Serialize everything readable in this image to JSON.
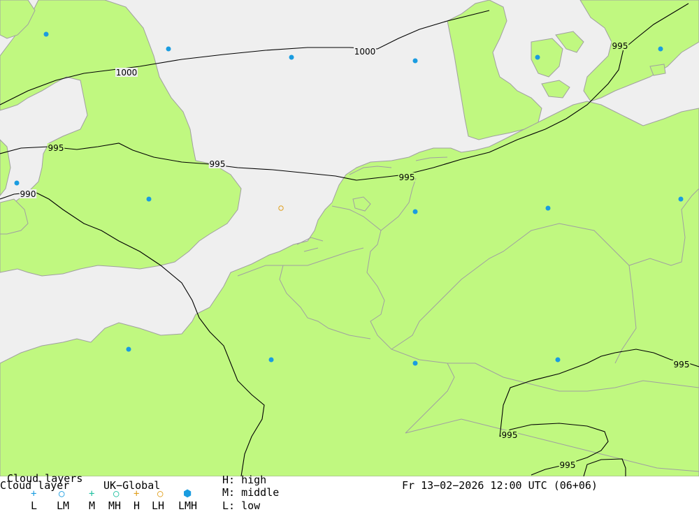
{
  "legend": {
    "title_overlay": "Cloud layers",
    "title": "Cloud layer",
    "model": "UK−Global",
    "symbols": [
      {
        "label": "L",
        "glyph": "+",
        "color": "#1a9ce0"
      },
      {
        "label": "LM",
        "glyph": "○",
        "color": "#1a9ce0"
      },
      {
        "label": "M",
        "glyph": "+",
        "color": "#20c0a0"
      },
      {
        "label": "MH",
        "glyph": "○",
        "color": "#20c0a0"
      },
      {
        "label": "H",
        "glyph": "+",
        "color": "#e0a020"
      },
      {
        "label": "LH",
        "glyph": "○",
        "color": "#e0a020"
      },
      {
        "label": "LMH",
        "glyph": "⬢",
        "color": "#1a9ce0"
      }
    ],
    "key": {
      "high": "H: high",
      "middle": "M: middle",
      "low": "L: low"
    }
  },
  "valid_time": "Fr 13−02−2026 12:00 UTC (06+06)",
  "isobars": [
    {
      "value": "1000"
    },
    {
      "value": "1000"
    },
    {
      "value": "995"
    },
    {
      "value": "995"
    },
    {
      "value": "995"
    },
    {
      "value": "990"
    },
    {
      "value": "995"
    },
    {
      "value": "995"
    },
    {
      "value": "995"
    },
    {
      "value": "995"
    }
  ],
  "markers": {
    "lmh_color": "#1a9ce0",
    "lh_color": "#e0a020"
  },
  "colors": {
    "land": "#c0f880",
    "sea": "#efefef",
    "isobar": "#000000"
  }
}
